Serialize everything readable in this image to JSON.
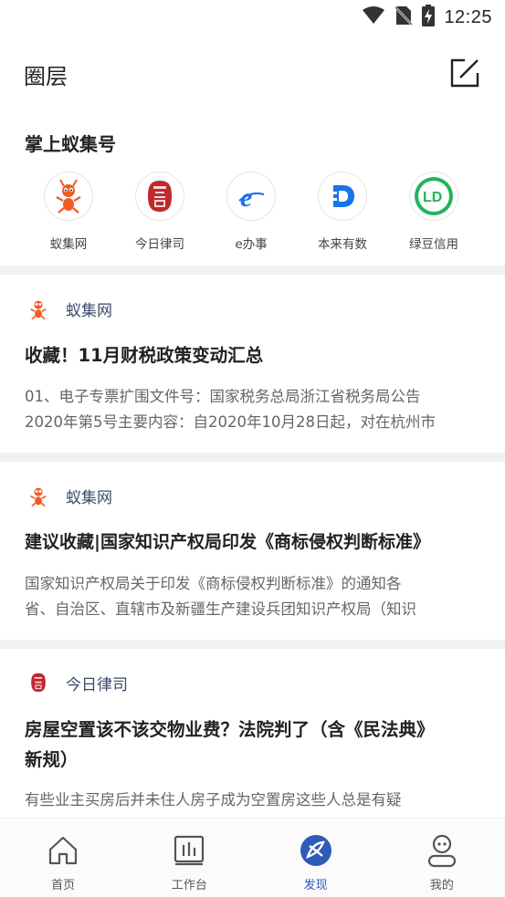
{
  "status_bar": {
    "time": "12:25"
  },
  "header": {
    "title": "圈层"
  },
  "section": {
    "title": "掌上蚁集号",
    "apps": [
      {
        "label": "蚁集网",
        "icon": "ant-logo-icon"
      },
      {
        "label": "今日律司",
        "icon": "lusi-seal-icon"
      },
      {
        "label": "e办事",
        "icon": "e-logo-icon"
      },
      {
        "label": "本来有数",
        "icon": "d-logo-icon"
      },
      {
        "label": "绿豆信用",
        "icon": "ld-logo-icon"
      }
    ]
  },
  "feed": [
    {
      "source": "蚁集网",
      "title": "收藏！11月财税政策变动汇总",
      "excerpt_lines": [
        "01、电子专票扩围文件号：国家税务总局浙江省税务局公告",
        "2020年第5号主要内容：自2020年10月28日起，对在杭州市"
      ]
    },
    {
      "source": "蚁集网",
      "title": "建议收藏|国家知识产权局印发《商标侵权判断标准》",
      "excerpt_lines": [
        "国家知识产权局关于印发《商标侵权判断标准》的通知各",
        "省、自治区、直辖市及新疆生产建设兵团知识产权局（知识"
      ]
    },
    {
      "source": "今日律司",
      "title_lines": [
        "房屋空置该不该交物业费？法院判了（含《民法典》",
        "新规）"
      ],
      "excerpt_lines": [
        "有些业主买房后并未住人房子成为空置房这些人总是有疑"
      ]
    }
  ],
  "bottom_nav": {
    "items": [
      {
        "label": "首页",
        "icon": "home-icon",
        "active": false
      },
      {
        "label": "工作台",
        "icon": "workbench-icon",
        "active": false
      },
      {
        "label": "发现",
        "icon": "discover-icon",
        "active": true
      },
      {
        "label": "我的",
        "icon": "profile-icon",
        "active": false
      }
    ]
  },
  "colors": {
    "accent": "#2f5ab8",
    "ant_orange": "#f05a23",
    "lusi_red": "#c1272d",
    "e_blue": "#1a73e8",
    "ld_green": "#1fb55a"
  }
}
